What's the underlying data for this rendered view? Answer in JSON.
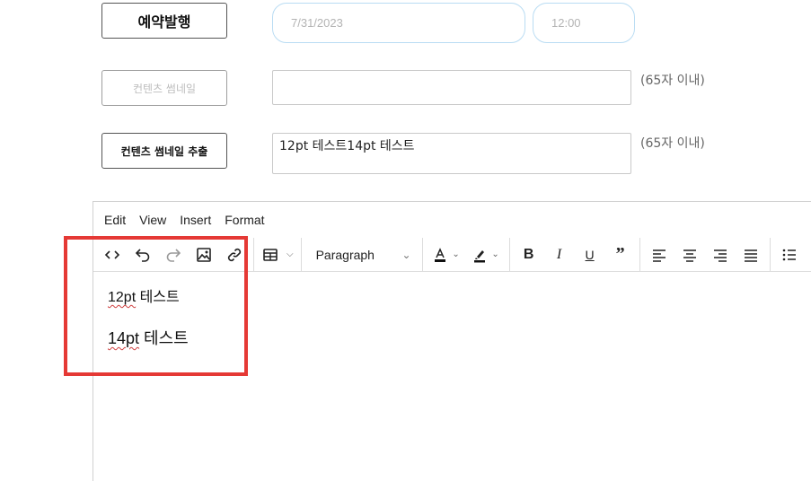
{
  "form": {
    "publish_button": "예약발행",
    "date_value": "7/31/2023",
    "time_value": "12:00",
    "thumbnail_button": "컨텐츠 썸네일",
    "thumbnail_field_value": "",
    "thumbnail_hint": "(65자 이내)",
    "extract_button": "컨텐츠 썸네일 추출",
    "extract_field_value": "12pt 테스트14pt 테스트",
    "extract_hint": "(65자 이내)"
  },
  "editor": {
    "menu": [
      "Edit",
      "View",
      "Insert",
      "Format"
    ],
    "block_format": "Paragraph",
    "toolbar_icons": [
      "code-icon",
      "undo-icon",
      "redo-icon",
      "image-icon",
      "link-icon",
      "table-icon",
      "text-color-icon",
      "highlight-color-icon",
      "bold-icon",
      "italic-icon",
      "underline-icon",
      "blockquote-icon",
      "align-left-icon",
      "align-center-icon",
      "align-right-icon",
      "align-justify-icon",
      "bullet-list-icon"
    ],
    "paragraphs": [
      {
        "prefix": "12pt",
        "rest": " 테스트"
      },
      {
        "prefix": "14pt",
        "rest": " 테스트"
      }
    ]
  },
  "colors": {
    "highlight_border": "#e53935",
    "pill_border": "#b9dcf3"
  }
}
